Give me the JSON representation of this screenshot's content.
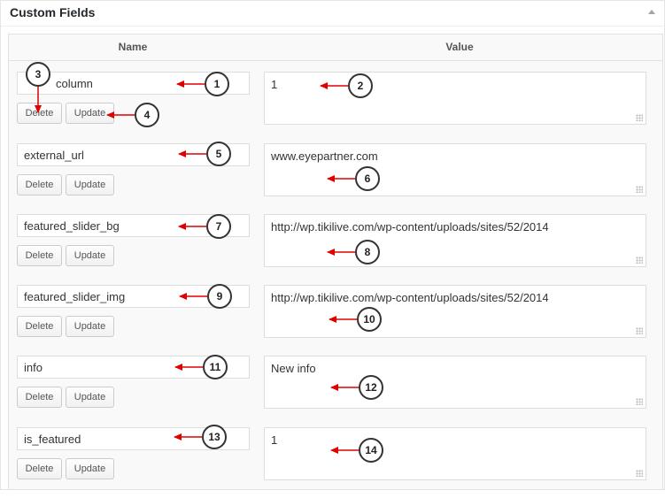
{
  "panel": {
    "title": "Custom Fields",
    "toggle_icon": "triangle-up-icon"
  },
  "table": {
    "name_header": "Name",
    "value_header": "Value"
  },
  "buttons": {
    "delete_label": "Delete",
    "update_label": "Update"
  },
  "fields": [
    {
      "key": "column",
      "value": "1"
    },
    {
      "key": "external_url",
      "value": "www.eyepartner.com"
    },
    {
      "key": "featured_slider_bg",
      "value": "http://wp.tikilive.com/wp-content/uploads/sites/52/2014"
    },
    {
      "key": "featured_slider_img",
      "value": "http://wp.tikilive.com/wp-content/uploads/sites/52/2014"
    },
    {
      "key": "info",
      "value": "New info"
    },
    {
      "key": "is_featured",
      "value": "1"
    }
  ],
  "callouts": [
    "1",
    "2",
    "3",
    "4",
    "5",
    "6",
    "7",
    "8",
    "9",
    "10",
    "11",
    "12",
    "13",
    "14"
  ],
  "colors": {
    "arrow": "#e00000",
    "callout_border": "#333333"
  }
}
